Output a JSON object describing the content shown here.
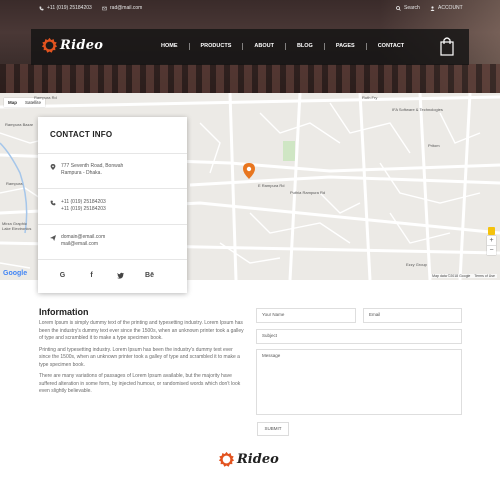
{
  "topbar": {
    "phone": "+11 (019) 25184203",
    "email": "rad@mail.com",
    "search": "Search",
    "account": "ACCOUNT"
  },
  "brand": {
    "logo_text": "Rideo",
    "accent": "#e2531f"
  },
  "nav": {
    "items": [
      {
        "label": "HOME"
      },
      {
        "label": "PRODUCTS"
      },
      {
        "label": "ABOUT"
      },
      {
        "label": "BLOG"
      },
      {
        "label": "PAGES"
      },
      {
        "label": "CONTACT"
      }
    ]
  },
  "map": {
    "tabs": [
      {
        "label": "Map"
      },
      {
        "label": "Satellite"
      }
    ],
    "labels": [
      {
        "text": "Rampura Rd"
      },
      {
        "text": "Rampura Bazar"
      },
      {
        "text": "Rampura"
      },
      {
        "text": "Mirza Graphic"
      },
      {
        "text": "Lake Electronics"
      },
      {
        "text": "Ruth Fry"
      },
      {
        "text": "IFA Software & Technologies"
      },
      {
        "text": "Pritom"
      },
      {
        "text": "Ezzy Group"
      },
      {
        "text": "E Rampura Rd"
      },
      {
        "text": "Puthia Rampura Rd"
      }
    ],
    "zoom_in": "+",
    "zoom_out": "−",
    "footer": [
      "Map data ©2018 Google",
      "Terms of Use"
    ],
    "google": "Google"
  },
  "contact_card": {
    "title": "CONTACT INFO",
    "address_line1": "777 Seventh Road, Bonwah",
    "address_line2": "Rampura - Dhaka.",
    "phone1": "+11 (019) 25184203",
    "phone2": "+11 (019) 25184203",
    "email1": "domain@email.com",
    "email2": "mail@email.com",
    "socials": [
      {
        "label": "G"
      },
      {
        "label": "f"
      },
      {
        "label": "🐦"
      },
      {
        "label": "Bē"
      }
    ]
  },
  "information": {
    "title": "Information",
    "paragraphs": [
      "Lorem Ipsum is simply dummy text of the printing and typesetting industry. Lorem Ipsum has been the industry's dummy text ever since the 1500s, when an unknown printer took a galley of type and scrambled it to make a type specimen book.",
      "Printing and typesetting industry. Lorem Ipsum has been the industry's dummy text ever since the 1500s, when an unknown printer took a galley of type and scrambled it to make a type specimen book.",
      "There are many variations of passages of Lorem Ipsum available, but the majority have suffered alteration in some form, by injected humour, or randomised words which don't look even slightly believable."
    ]
  },
  "form": {
    "name_placeholder": "Your Name",
    "email_placeholder": "Email",
    "subject_placeholder": "Subject",
    "message_placeholder": "Message",
    "submit_label": "SUBMIT"
  }
}
